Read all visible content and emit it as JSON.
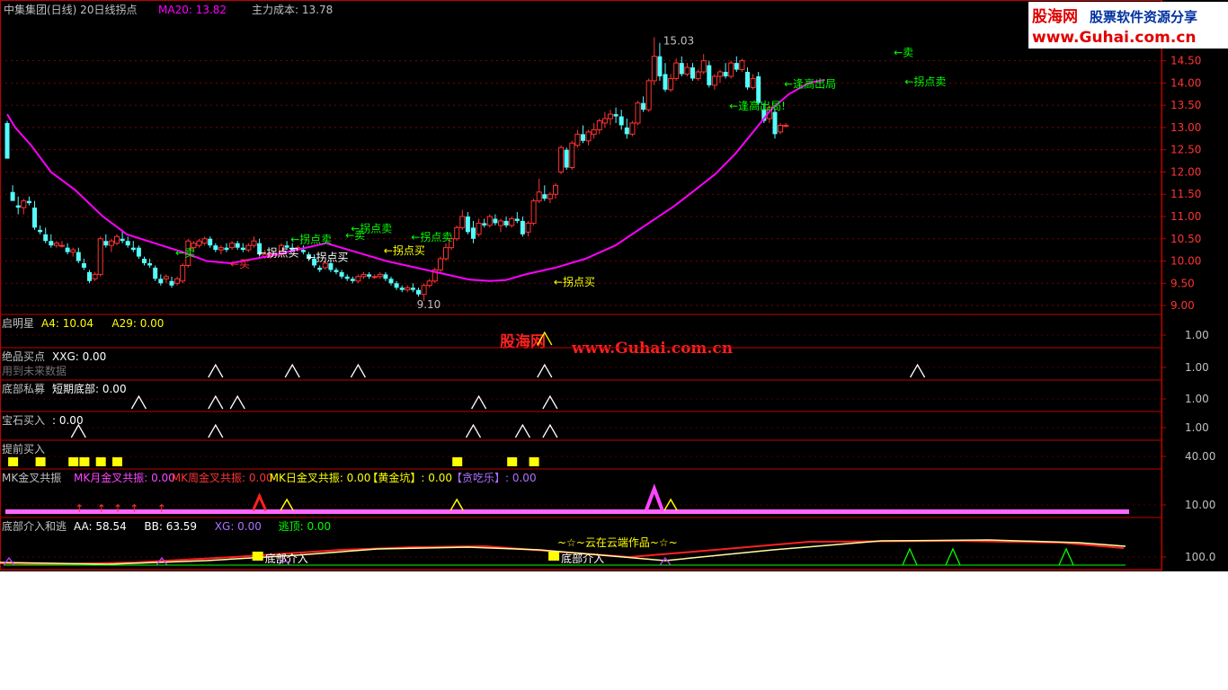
{
  "colors": {
    "bg": "#000000",
    "frame": "#c00000",
    "grid": "#a00000",
    "up": "#ff3333",
    "down": "#54fcfc",
    "ma": "#ff00ff",
    "yellow": "#ffff00",
    "green": "#00ff00",
    "white": "#ffffff",
    "gray": "#c0c0c0"
  },
  "header": {
    "title": "中集集团(日线) 20日线拐点",
    "ma_label": "MA20: 13.82",
    "cost_label": "主力成本: 13.78"
  },
  "logo": {
    "brand": "股海网",
    "slogan": "股票软件资源分享",
    "url": "www.Guhai.com.cn"
  },
  "watermark": {
    "brand": "股海网",
    "url": "www.Guhai.com.cn"
  },
  "chart_data": {
    "type": "candlestick",
    "price_axis": {
      "ticks": [
        "14.50",
        "14.00",
        "13.50",
        "13.00",
        "12.50",
        "12.00",
        "11.50",
        "11.00",
        "10.50",
        "10.00",
        "9.50",
        "9.00"
      ],
      "ylim": [
        8.9,
        15.3
      ]
    },
    "high_label": "15.03",
    "low_label": "9.10",
    "ohlc": [
      [
        13.1,
        13.15,
        12.35,
        12.3
      ],
      [
        11.55,
        11.7,
        11.4,
        11.35
      ],
      [
        11.25,
        11.45,
        11.05,
        11.2
      ],
      [
        11.2,
        11.4,
        11.05,
        11.35
      ],
      [
        11.35,
        11.45,
        11.25,
        11.3
      ],
      [
        11.2,
        11.35,
        10.7,
        10.75
      ],
      [
        10.7,
        10.8,
        10.6,
        10.65
      ],
      [
        10.6,
        10.75,
        10.4,
        10.45
      ],
      [
        10.45,
        10.6,
        10.3,
        10.35
      ],
      [
        10.35,
        10.45,
        10.3,
        10.4
      ],
      [
        10.35,
        10.45,
        10.3,
        10.35
      ],
      [
        10.3,
        10.4,
        10.15,
        10.2
      ],
      [
        10.2,
        10.3,
        10.1,
        10.25
      ],
      [
        10.2,
        10.3,
        9.95,
        10.0
      ],
      [
        9.95,
        10.05,
        9.8,
        9.85
      ],
      [
        9.75,
        9.8,
        9.5,
        9.55
      ],
      [
        9.6,
        9.75,
        9.55,
        9.7
      ],
      [
        9.7,
        10.55,
        9.65,
        10.5
      ],
      [
        10.45,
        10.6,
        10.3,
        10.35
      ],
      [
        10.35,
        10.5,
        10.2,
        10.45
      ],
      [
        10.4,
        10.6,
        10.35,
        10.55
      ],
      [
        10.5,
        10.7,
        10.4,
        10.45
      ],
      [
        10.45,
        10.55,
        10.3,
        10.35
      ],
      [
        10.3,
        10.45,
        10.2,
        10.25
      ],
      [
        10.3,
        10.35,
        10.05,
        10.1
      ],
      [
        10.05,
        10.1,
        9.9,
        9.95
      ],
      [
        9.95,
        10.05,
        9.85,
        9.9
      ],
      [
        9.85,
        9.9,
        9.55,
        9.6
      ],
      [
        9.6,
        9.7,
        9.45,
        9.5
      ],
      [
        9.6,
        9.7,
        9.5,
        9.65
      ],
      [
        9.55,
        9.65,
        9.4,
        9.45
      ],
      [
        9.5,
        9.65,
        9.45,
        9.6
      ],
      [
        9.55,
        9.95,
        9.5,
        9.9
      ],
      [
        9.9,
        10.5,
        9.85,
        10.45
      ],
      [
        10.3,
        10.45,
        10.2,
        10.4
      ],
      [
        10.35,
        10.5,
        10.3,
        10.45
      ],
      [
        10.4,
        10.55,
        10.35,
        10.5
      ],
      [
        10.5,
        10.55,
        10.3,
        10.35
      ],
      [
        10.35,
        10.4,
        10.2,
        10.25
      ],
      [
        10.25,
        10.35,
        10.15,
        10.3
      ],
      [
        10.3,
        10.4,
        10.2,
        10.25
      ],
      [
        10.3,
        10.45,
        10.25,
        10.4
      ],
      [
        10.4,
        10.45,
        10.25,
        10.3
      ],
      [
        10.3,
        10.4,
        10.2,
        10.25
      ],
      [
        10.25,
        10.4,
        10.2,
        10.35
      ],
      [
        10.35,
        10.55,
        10.3,
        10.45
      ],
      [
        10.4,
        10.5,
        10.1,
        10.15
      ],
      [
        10.1,
        10.25,
        10.05,
        10.15
      ],
      [
        10.1,
        10.2,
        10.05,
        10.15
      ],
      [
        10.15,
        10.2,
        10.1,
        10.15
      ],
      [
        10.15,
        10.4,
        10.1,
        10.35
      ],
      [
        10.35,
        10.45,
        10.25,
        10.3
      ],
      [
        10.3,
        10.4,
        10.2,
        10.25
      ],
      [
        10.25,
        10.35,
        10.2,
        10.3
      ],
      [
        10.25,
        10.35,
        10.15,
        10.2
      ],
      [
        10.15,
        10.2,
        10.0,
        10.05
      ],
      [
        10.05,
        10.15,
        9.85,
        9.9
      ],
      [
        9.85,
        9.9,
        9.75,
        9.8
      ],
      [
        9.85,
        10.0,
        9.8,
        9.95
      ],
      [
        9.95,
        10.05,
        9.75,
        9.8
      ],
      [
        9.8,
        9.85,
        9.7,
        9.75
      ],
      [
        9.75,
        9.8,
        9.6,
        9.65
      ],
      [
        9.65,
        9.7,
        9.55,
        9.6
      ],
      [
        9.6,
        9.65,
        9.5,
        9.55
      ],
      [
        9.55,
        9.7,
        9.5,
        9.65
      ],
      [
        9.65,
        9.75,
        9.6,
        9.7
      ],
      [
        9.7,
        9.75,
        9.6,
        9.65
      ],
      [
        9.65,
        9.7,
        9.6,
        9.65
      ],
      [
        9.65,
        9.75,
        9.6,
        9.7
      ],
      [
        9.7,
        9.75,
        9.55,
        9.6
      ],
      [
        9.6,
        9.65,
        9.45,
        9.5
      ],
      [
        9.5,
        9.55,
        9.35,
        9.4
      ],
      [
        9.4,
        9.45,
        9.3,
        9.35
      ],
      [
        9.35,
        9.45,
        9.3,
        9.4
      ],
      [
        9.4,
        9.5,
        9.3,
        9.35
      ],
      [
        9.35,
        9.4,
        9.2,
        9.25
      ],
      [
        9.25,
        9.5,
        9.1,
        9.45
      ],
      [
        9.45,
        9.6,
        9.4,
        9.55
      ],
      [
        9.55,
        9.85,
        9.5,
        9.8
      ],
      [
        9.8,
        10.1,
        9.75,
        10.05
      ],
      [
        10.05,
        10.4,
        10.0,
        10.3
      ],
      [
        10.3,
        10.55,
        10.25,
        10.5
      ],
      [
        10.5,
        10.8,
        10.45,
        10.75
      ],
      [
        10.75,
        11.15,
        10.7,
        11.0
      ],
      [
        11.0,
        11.1,
        10.6,
        10.65
      ],
      [
        10.75,
        10.9,
        10.4,
        10.5
      ],
      [
        10.6,
        10.95,
        10.55,
        10.85
      ],
      [
        10.85,
        10.95,
        10.75,
        10.8
      ],
      [
        10.8,
        11.05,
        10.75,
        11.0
      ],
      [
        10.95,
        11.05,
        10.8,
        10.85
      ],
      [
        10.8,
        10.95,
        10.65,
        10.9
      ],
      [
        10.9,
        11.0,
        10.75,
        10.8
      ],
      [
        10.8,
        11.0,
        10.75,
        10.95
      ],
      [
        10.95,
        11.1,
        10.85,
        10.9
      ],
      [
        10.9,
        11.0,
        10.55,
        10.6
      ],
      [
        10.65,
        10.9,
        10.55,
        10.85
      ],
      [
        10.85,
        11.4,
        10.8,
        11.35
      ],
      [
        11.35,
        11.85,
        11.3,
        11.55
      ],
      [
        11.5,
        11.7,
        11.35,
        11.4
      ],
      [
        11.4,
        11.55,
        11.3,
        11.5
      ],
      [
        11.5,
        11.75,
        11.4,
        11.7
      ],
      [
        12.0,
        12.6,
        11.95,
        12.55
      ],
      [
        12.5,
        12.55,
        12.05,
        12.1
      ],
      [
        12.1,
        12.7,
        12.05,
        12.65
      ],
      [
        12.6,
        12.95,
        12.55,
        12.85
      ],
      [
        12.85,
        13.05,
        12.65,
        12.7
      ],
      [
        12.7,
        12.95,
        12.6,
        12.9
      ],
      [
        12.85,
        13.1,
        12.75,
        12.95
      ],
      [
        12.95,
        13.2,
        12.85,
        13.15
      ],
      [
        13.1,
        13.35,
        13.0,
        13.2
      ],
      [
        13.2,
        13.4,
        13.05,
        13.3
      ],
      [
        13.3,
        13.45,
        13.1,
        13.25
      ],
      [
        13.25,
        13.4,
        12.95,
        13.05
      ],
      [
        13.0,
        13.2,
        12.75,
        12.85
      ],
      [
        12.85,
        13.15,
        12.8,
        13.1
      ],
      [
        13.1,
        13.6,
        13.05,
        13.55
      ],
      [
        13.55,
        13.7,
        13.35,
        13.4
      ],
      [
        13.4,
        14.1,
        13.35,
        14.05
      ],
      [
        14.05,
        15.03,
        13.95,
        14.6
      ],
      [
        14.6,
        14.9,
        14.05,
        14.15
      ],
      [
        14.2,
        14.45,
        13.8,
        13.85
      ],
      [
        13.85,
        14.2,
        13.8,
        14.1
      ],
      [
        14.1,
        14.55,
        14.05,
        14.45
      ],
      [
        14.45,
        14.6,
        14.15,
        14.2
      ],
      [
        14.2,
        14.45,
        14.15,
        14.35
      ],
      [
        14.35,
        14.45,
        14.05,
        14.1
      ],
      [
        14.1,
        14.3,
        14.05,
        14.25
      ],
      [
        14.25,
        14.65,
        14.2,
        14.5
      ],
      [
        14.4,
        14.5,
        13.9,
        13.95
      ],
      [
        13.95,
        14.2,
        13.85,
        14.15
      ],
      [
        14.15,
        14.3,
        14.0,
        14.25
      ],
      [
        14.25,
        14.45,
        14.1,
        14.15
      ],
      [
        14.15,
        14.5,
        14.1,
        14.45
      ],
      [
        14.45,
        14.6,
        14.25,
        14.3
      ],
      [
        14.3,
        14.55,
        14.25,
        14.5
      ],
      [
        14.25,
        14.35,
        13.85,
        13.9
      ],
      [
        13.9,
        14.2,
        13.85,
        14.1
      ],
      [
        14.15,
        14.25,
        13.5,
        13.55
      ],
      [
        13.4,
        13.55,
        13.1,
        13.15
      ],
      [
        13.2,
        13.5,
        13.1,
        13.45
      ],
      [
        13.35,
        13.4,
        12.75,
        12.85
      ],
      [
        12.9,
        13.1,
        12.85,
        13.05
      ],
      [
        13.05,
        13.1,
        13.0,
        13.05
      ]
    ],
    "ma20": [
      [
        0,
        13.3
      ],
      [
        4,
        13.0
      ],
      [
        12,
        12.6
      ],
      [
        22,
        12.0
      ],
      [
        34,
        11.6
      ],
      [
        48,
        11.0
      ],
      [
        60,
        10.6
      ],
      [
        74,
        10.4
      ],
      [
        88,
        10.2
      ],
      [
        100,
        10.0
      ],
      [
        112,
        9.95
      ],
      [
        130,
        10.1
      ],
      [
        145,
        10.25
      ],
      [
        160,
        10.4
      ],
      [
        175,
        10.2
      ],
      [
        190,
        10.0
      ],
      [
        205,
        9.85
      ],
      [
        220,
        9.7
      ],
      [
        232,
        9.58
      ],
      [
        242,
        9.55
      ],
      [
        250,
        9.57
      ],
      [
        260,
        9.7
      ],
      [
        275,
        9.85
      ],
      [
        290,
        10.05
      ],
      [
        305,
        10.35
      ],
      [
        320,
        10.8
      ],
      [
        335,
        11.25
      ],
      [
        345,
        11.6
      ],
      [
        355,
        11.95
      ],
      [
        365,
        12.4
      ],
      [
        375,
        12.95
      ],
      [
        383,
        13.4
      ],
      [
        392,
        13.75
      ],
      [
        402,
        14.0
      ],
      [
        410,
        14.07
      ]
    ],
    "price_signals": [
      {
        "text": "←卖",
        "i": 30,
        "price": 10.1,
        "color": "green"
      },
      {
        "text": "←买",
        "i": 40,
        "price": 9.85,
        "color": "red"
      },
      {
        "text": "←拐点买",
        "i": 45,
        "price": 10.1,
        "color": "white"
      },
      {
        "text": "←拐点卖",
        "i": 51,
        "price": 10.4,
        "color": "green"
      },
      {
        "text": "←拐点买",
        "i": 54,
        "price": 10.0,
        "color": "white"
      },
      {
        "text": "←卖",
        "i": 61,
        "price": 10.5,
        "color": "green"
      },
      {
        "text": "←拐点卖",
        "i": 62,
        "price": 10.65,
        "color": "green"
      },
      {
        "text": "←拐点买",
        "i": 68,
        "price": 10.15,
        "color": "yellow"
      },
      {
        "text": "←拐点卖",
        "i": 73,
        "price": 10.45,
        "color": "green"
      },
      {
        "text": "←拐点买",
        "i": 99,
        "price": 9.45,
        "color": "yellow"
      },
      {
        "text": "←逢高出局!",
        "i": 131,
        "price": 13.4,
        "color": "green"
      },
      {
        "text": "←逢高出局",
        "i": 141,
        "price": 13.9,
        "color": "green"
      },
      {
        "text": "←卖",
        "i": 161,
        "price": 14.6,
        "color": "green"
      },
      {
        "text": "←拐点卖",
        "i": 163,
        "price": 13.95,
        "color": "green"
      }
    ],
    "panels": [
      {
        "title": "启明星",
        "labels": [
          {
            "t": "A4: 10.04",
            "c": "yellow"
          },
          {
            "t": "A29: 0.00",
            "c": "yellow"
          }
        ],
        "tick": "1.00",
        "markers": [
          {
            "i": 98,
            "color": "yellow"
          }
        ]
      },
      {
        "title": "绝品买点",
        "labels": [
          {
            "t": "XXG: 0.00",
            "c": "white"
          }
        ],
        "sub": "用到未来数据",
        "tick": "1.00",
        "markers": [
          {
            "i": 38,
            "color": "white"
          },
          {
            "i": 52,
            "color": "white"
          },
          {
            "i": 64,
            "color": "white"
          },
          {
            "i": 98,
            "color": "white"
          },
          {
            "i": 166,
            "color": "white"
          }
        ]
      },
      {
        "title": "底部私募",
        "labels": [
          {
            "t": "短期底部: 0.00",
            "c": "white"
          }
        ],
        "tick": "1.00",
        "markers": [
          {
            "i": 24,
            "color": "white"
          },
          {
            "i": 38,
            "color": "white"
          },
          {
            "i": 42,
            "color": "white"
          },
          {
            "i": 86,
            "color": "white"
          },
          {
            "i": 99,
            "color": "white"
          }
        ]
      },
      {
        "title": "宝石买入",
        "labels": [
          {
            "t": ": 0.00",
            "c": "white"
          }
        ],
        "tick": "1.00",
        "markers": [
          {
            "i": 13,
            "color": "white"
          },
          {
            "i": 38,
            "color": "white"
          },
          {
            "i": 85,
            "color": "white"
          },
          {
            "i": 94,
            "color": "white"
          },
          {
            "i": 99,
            "color": "white"
          }
        ]
      },
      {
        "title": "提前买入",
        "labels": [],
        "tick": "40.00",
        "blocks": [
          1,
          6,
          12,
          14,
          17,
          20,
          82,
          92,
          96
        ]
      },
      {
        "title": "MK金叉共振",
        "labels": [
          {
            "t": "MK月金叉共振: 0.00",
            "c": "magenta"
          },
          {
            "t": "MK周金叉共振: 0.00",
            "c": "red"
          },
          {
            "t": "MK日金叉共振: 0.00",
            "c": "yellow"
          },
          {
            "t": "【黄金坑】: 0.00",
            "c": "yellow"
          },
          {
            "t": "【贪吃乐】: 0.00",
            "c": "violet"
          }
        ],
        "tick": "10.00"
      },
      {
        "title": "底部介入和逃",
        "labels": [
          {
            "t": "AA: 58.54",
            "c": "white"
          },
          {
            "t": "BB: 63.59",
            "c": "white"
          },
          {
            "t": "XG: 0.00",
            "c": "violet"
          },
          {
            "t": "逃顶: 0.00",
            "c": "green"
          }
        ],
        "tick": "100.0",
        "annotations": [
          {
            "t": "~☆~云在云端作品~☆~",
            "i": 90,
            "color": "yellow"
          },
          {
            "t": "底部介入",
            "i": 47,
            "color": "white"
          },
          {
            "t": "底部介入",
            "i": 101,
            "color": "white"
          }
        ]
      }
    ]
  }
}
